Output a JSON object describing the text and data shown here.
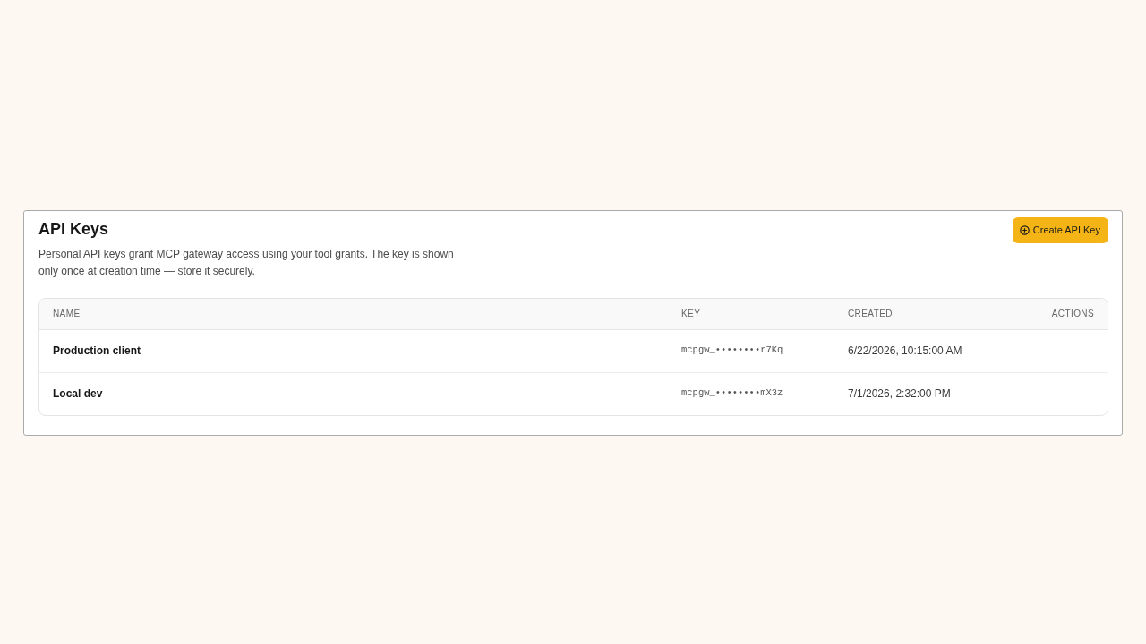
{
  "panel": {
    "title": "API Keys",
    "description": "Personal API keys grant MCP gateway access using your tool grants. The key is shown only once at creation time — store it securely.",
    "create_button": {
      "label": "Create API Key"
    }
  },
  "table": {
    "columns": [
      "NAME",
      "KEY",
      "CREATED",
      "ACTIONS"
    ],
    "rows": [
      {
        "name": "Production client",
        "key": "mcpgw_••••••••r7Kq",
        "created": "6/22/2026, 10:15:00 AM"
      },
      {
        "name": "Local dev",
        "key": "mcpgw_••••••••mX3z",
        "created": "7/1/2026, 2:32:00 PM"
      }
    ]
  }
}
